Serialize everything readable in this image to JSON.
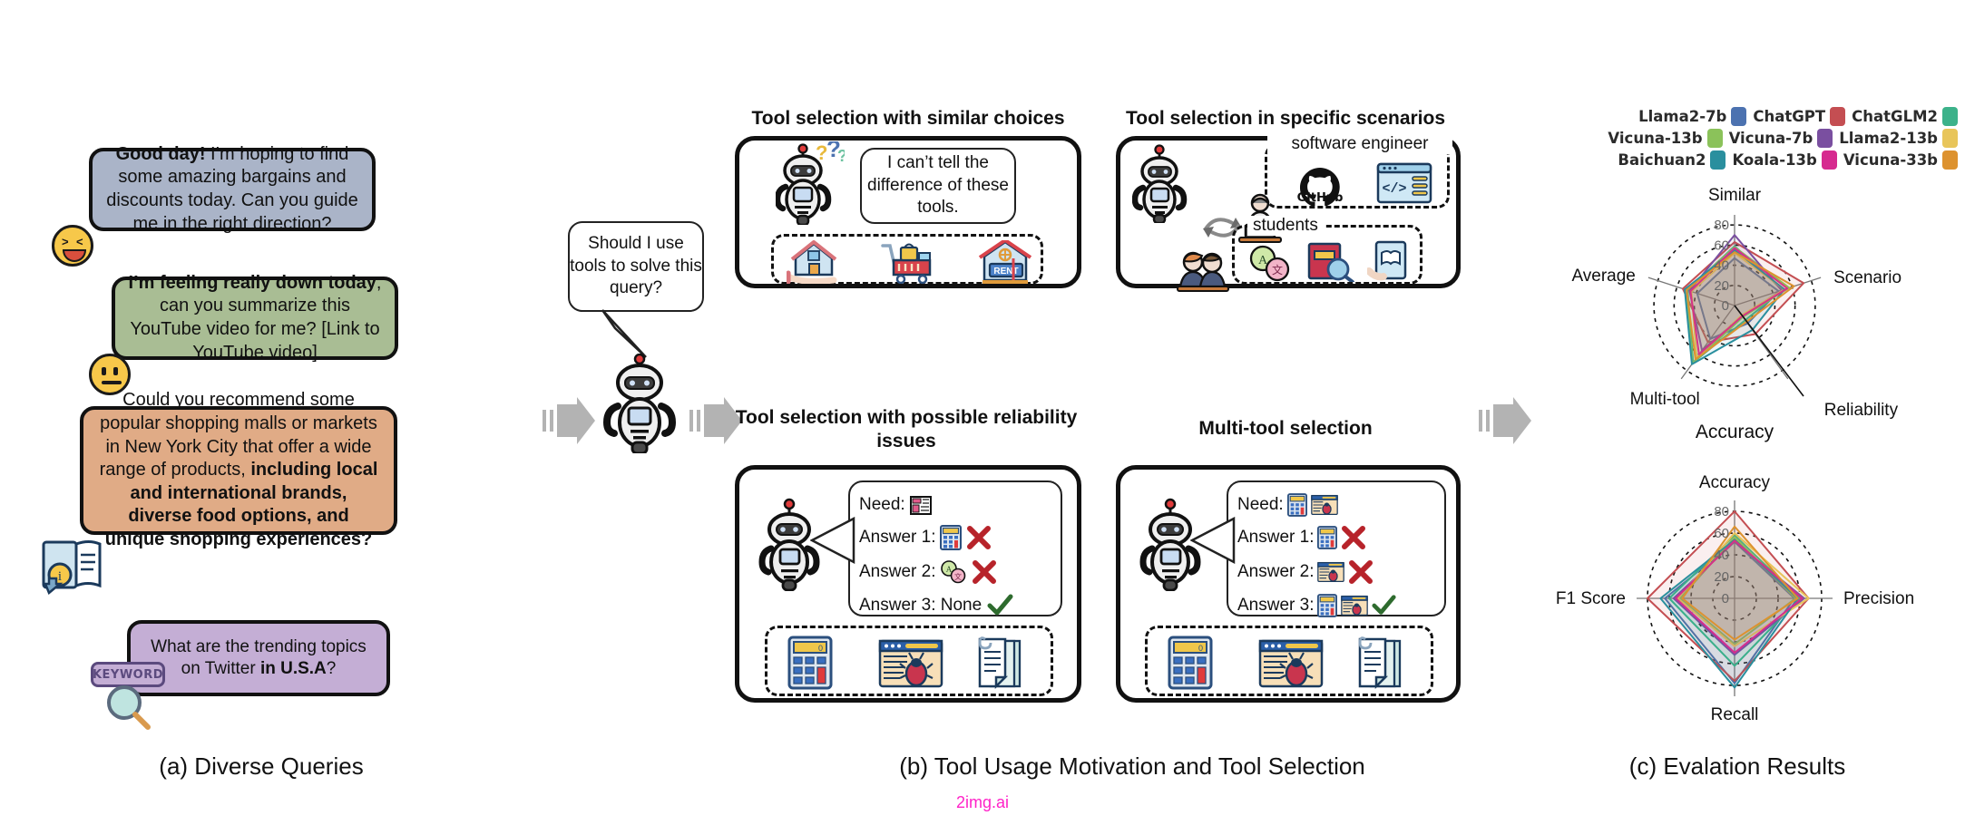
{
  "figure": {
    "captions": {
      "a": "(a) Diverse Queries",
      "b": "(b) Tool Usage Motivation and Tool Selection",
      "c": "(c) Evalation Results"
    },
    "watermark": "2img.ai"
  },
  "queries": [
    {
      "id": "query-greeting-shopping",
      "color": "#aab4c8",
      "bold_prefix": "Good day!",
      "text": " I’m hoping to find some amazing bargains and discounts today. Can you guide me in the right direction?",
      "emoji": "grinning-squint-face"
    },
    {
      "id": "query-youtube-summary",
      "color": "#a9bd94",
      "bold_prefix": "I’m feeling really down today",
      "text": ", can you summarize this YouTube video for me? [Link to YouTube video]",
      "emoji": "neutral-face"
    },
    {
      "id": "query-nyc-shopping",
      "color": "#e0ab86",
      "text_plain": "Could you recommend some popular shopping malls or markets in New York City that offer a wide range of products,",
      "text_bold": " including local and international brands, diverse food options, and unique shopping experiences?",
      "icon": "book-info-icon"
    },
    {
      "id": "query-twitter-trends",
      "color": "#c4aed5",
      "text_plain": "What are the trending topics on Twitter ",
      "text_bold": "in U.S.A",
      "text_suffix": "?",
      "badge": "KEYWORD",
      "icon": "magnifier-icon"
    }
  ],
  "center": {
    "speech": "Should I use tools to solve this query?",
    "robot": "robot-icon",
    "arrow_left": "arrow-right-icon",
    "arrow_right": "arrow-right-icon"
  },
  "panels": [
    {
      "id": "panel-similar-choices",
      "title": "Tool selection with similar choices",
      "speech": "I can’t tell the difference of these tools.",
      "robot_state": "confused-robot-with-question-marks",
      "tools": [
        "house-in-hand-icon",
        "shopping-cart-icon",
        "rent-house-icon"
      ]
    },
    {
      "id": "panel-specific-scenarios",
      "title": "Tool selection in specific scenarios",
      "groups": [
        {
          "label": "software engineer",
          "actor": "developer-at-laptop-icon",
          "tools": [
            "github-icon",
            "code-window-icon"
          ]
        },
        {
          "label": "students",
          "actor": "students-icon",
          "tools": [
            "translate-bubbles-icon",
            "book-magnifier-icon",
            "tablet-reading-icon"
          ]
        }
      ]
    },
    {
      "id": "panel-reliability-issues",
      "title": "Tool selection with possible reliability issues",
      "lines": [
        {
          "label": "Need:",
          "icons": [
            "news-icon"
          ],
          "mark": ""
        },
        {
          "label": "Answer 1:",
          "icons": [
            "calculator-icon"
          ],
          "mark": "cross"
        },
        {
          "label": "Answer 2:",
          "icons": [
            "translate-bubbles-icon"
          ],
          "mark": "cross"
        },
        {
          "label": "Answer 3: None",
          "icons": [],
          "mark": "check"
        }
      ],
      "tools": [
        "calculator-icon",
        "bug-browser-icon",
        "document-icon"
      ]
    },
    {
      "id": "panel-multi-tool",
      "title": "Multi-tool selection",
      "lines": [
        {
          "label": "Need:",
          "icons": [
            "calculator-icon",
            "bug-browser-icon"
          ],
          "mark": ""
        },
        {
          "label": "Answer 1:",
          "icons": [
            "calculator-icon"
          ],
          "mark": "cross"
        },
        {
          "label": "Answer 2:",
          "icons": [
            "bug-browser-icon"
          ],
          "mark": "cross"
        },
        {
          "label": "Answer 3:",
          "icons": [
            "calculator-icon",
            "bug-browser-icon"
          ],
          "mark": "check"
        }
      ],
      "tools": [
        "calculator-icon",
        "bug-browser-icon",
        "document-icon"
      ]
    }
  ],
  "legend": {
    "rows": [
      [
        {
          "label": "Llama2-7b",
          "color": "#4c72b0"
        },
        {
          "label": "ChatGPT",
          "color": "#c44e52"
        },
        {
          "label": "ChatGLM2",
          "color": "#3cb28a"
        }
      ],
      [
        {
          "label": "Vicuna-13b",
          "color": "#8bc25a"
        },
        {
          "label": "Vicuna-7b",
          "color": "#7a4fa0"
        },
        {
          "label": "Llama2-13b",
          "color": "#f1c council"
        }
      ],
      [
        {
          "label": "Baichuan2",
          "color": "#2a8f9e"
        },
        {
          "label": "Koala-13b",
          "color": "#d62a8f"
        },
        {
          "label": "Vicuna-33b",
          "color": "#dd922f"
        }
      ]
    ]
  },
  "chart_data": [
    {
      "id": "radar-accuracy",
      "type": "radar",
      "title": "Accuracy",
      "categories": [
        "Similar",
        "Scenario",
        "Reliability",
        "Multi-tool",
        "Average"
      ],
      "rmax": 90,
      "ticks": [
        0,
        20,
        40,
        60,
        80
      ],
      "grid": "dotted-circles",
      "legend_position": "top",
      "series": [
        {
          "name": "Llama2-7b",
          "color": "#4c72b0",
          "values": [
            47,
            46,
            22,
            41,
            39
          ]
        },
        {
          "name": "ChatGPT",
          "color": "#c44e52",
          "values": [
            63,
            72,
            35,
            45,
            54
          ]
        },
        {
          "name": "ChatGLM2",
          "color": "#3cb28a",
          "values": [
            59,
            50,
            18,
            70,
            49
          ]
        },
        {
          "name": "Vicuna-13b",
          "color": "#8bc25a",
          "values": [
            58,
            57,
            14,
            71,
            50
          ]
        },
        {
          "name": "Vicuna-7b",
          "color": "#7a4fa0",
          "values": [
            70,
            49,
            13,
            55,
            47
          ]
        },
        {
          "name": "Llama2-13b",
          "color": "#e8c55a",
          "values": [
            52,
            52,
            12,
            64,
            45
          ]
        },
        {
          "name": "Baichuan2",
          "color": "#2a8f9e",
          "values": [
            55,
            52,
            30,
            72,
            52
          ]
        },
        {
          "name": "Koala-13b",
          "color": "#d62a8f",
          "values": [
            57,
            55,
            13,
            60,
            46
          ]
        },
        {
          "name": "Vicuna-33b",
          "color": "#dd922f",
          "values": [
            53,
            62,
            20,
            66,
            50
          ]
        }
      ]
    },
    {
      "id": "radar-metrics",
      "type": "radar",
      "title": "",
      "categories": [
        "Accuracy",
        "Precision",
        "Recall",
        "F1 Score"
      ],
      "rmax": 90,
      "ticks": [
        0,
        20,
        40,
        60,
        80
      ],
      "grid": "dotted-circles",
      "legend_position": "top",
      "series": [
        {
          "name": "Llama2-7b",
          "color": "#4c72b0",
          "values": [
            52,
            55,
            78,
            64
          ]
        },
        {
          "name": "ChatGPT",
          "color": "#c44e52",
          "values": [
            80,
            68,
            76,
            80
          ]
        },
        {
          "name": "ChatGLM2",
          "color": "#3cb28a",
          "values": [
            58,
            60,
            62,
            60
          ]
        },
        {
          "name": "Vicuna-13b",
          "color": "#8bc25a",
          "values": [
            56,
            56,
            42,
            50
          ]
        },
        {
          "name": "Vicuna-7b",
          "color": "#7a4fa0",
          "values": [
            52,
            64,
            52,
            56
          ]
        },
        {
          "name": "Llama2-13b",
          "color": "#e8c55a",
          "values": [
            60,
            68,
            44,
            52
          ]
        },
        {
          "name": "Baichuan2",
          "color": "#2a8f9e",
          "values": [
            54,
            58,
            82,
            68
          ]
        },
        {
          "name": "Koala-13b",
          "color": "#d62a8f",
          "values": [
            53,
            62,
            50,
            54
          ]
        },
        {
          "name": "Vicuna-33b",
          "color": "#dd922f",
          "values": [
            66,
            58,
            38,
            48
          ]
        }
      ]
    }
  ]
}
